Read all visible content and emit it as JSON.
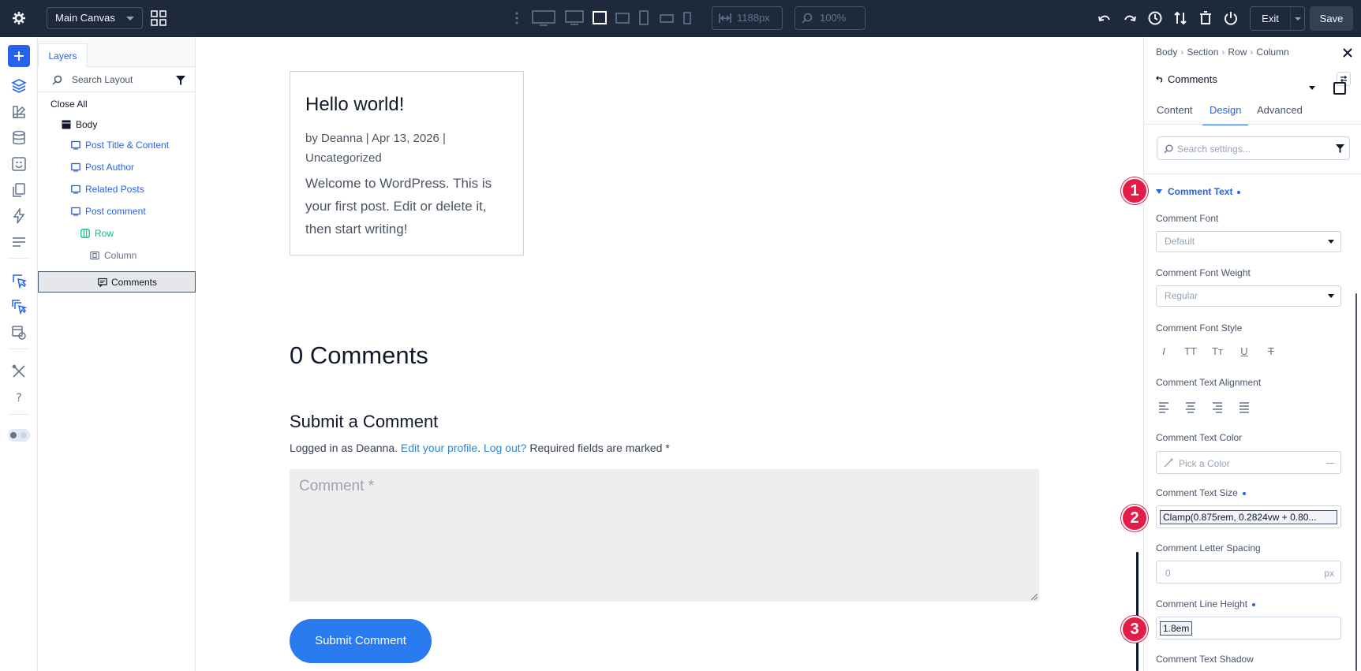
{
  "topbar": {
    "canvas_select": "Main Canvas",
    "width_value": "1188px",
    "zoom_value": "100%",
    "exit_label": "Exit",
    "save_label": "Save"
  },
  "layers": {
    "tab_label": "Layers",
    "search_placeholder": "Search Layout",
    "close_all": "Close All",
    "items": [
      {
        "label": "Body"
      },
      {
        "label": "Post Title & Content"
      },
      {
        "label": "Post Author"
      },
      {
        "label": "Related Posts"
      },
      {
        "label": "Post comment"
      },
      {
        "label": "Row"
      },
      {
        "label": "Column"
      },
      {
        "label": "Comments"
      }
    ]
  },
  "canvas": {
    "post_title": "Hello world!",
    "post_meta": "by Deanna | Apr 13, 2026 | Uncategorized",
    "post_body": "Welcome to WordPress. This is your first post. Edit or delete it, then start writing!",
    "comments_count": "0 Comments",
    "submit_heading": "Submit a Comment",
    "logged_prefix": "Logged in as Deanna.",
    "edit_profile": "Edit your profile",
    "period": ".",
    "logout": "Log out?",
    "required": "Required fields are marked *",
    "comment_placeholder": "Comment *",
    "submit_button": "Submit Comment"
  },
  "settings": {
    "breadcrumb": [
      "Body",
      "Section",
      "Row",
      "Column"
    ],
    "module_name": "Comments",
    "tabs": [
      "Content",
      "Design",
      "Advanced"
    ],
    "active_tab": "Design",
    "search_placeholder": "Search settings...",
    "group_title": "Comment Text",
    "comment_font_label": "Comment Font",
    "comment_font_value": "Default",
    "font_weight_label": "Comment Font Weight",
    "font_weight_value": "Regular",
    "font_style_label": "Comment Font Style",
    "text_alignment_label": "Comment Text Alignment",
    "text_color_label": "Comment Text Color",
    "text_color_placeholder": "Pick a Color",
    "text_size_label": "Comment Text Size",
    "text_size_value": "Clamp(0.875rem, 0.2824vw + 0.80...",
    "letter_spacing_label": "Comment Letter Spacing",
    "letter_spacing_value": "0",
    "letter_spacing_unit": "px",
    "line_height_label": "Comment Line Height",
    "line_height_value": "1.8em",
    "text_shadow_label": "Comment Text Shadow"
  },
  "callouts": [
    "1",
    "2",
    "3"
  ],
  "colors": {
    "topbar": "#1e293b",
    "accent": "#2563eb",
    "callout": "#e11d48",
    "submit_button": "#2b7bf0",
    "link": "#2b87da",
    "row_green": "#10b981"
  },
  "icons": [
    "gear-icon",
    "grid-icon",
    "desktop-icon",
    "tablet-icon",
    "phone-icon",
    "undo-icon",
    "redo-icon",
    "history-icon",
    "sort-icon",
    "trash-icon",
    "power-icon",
    "layers-icon",
    "search-icon",
    "filter-icon",
    "close-icon"
  ]
}
